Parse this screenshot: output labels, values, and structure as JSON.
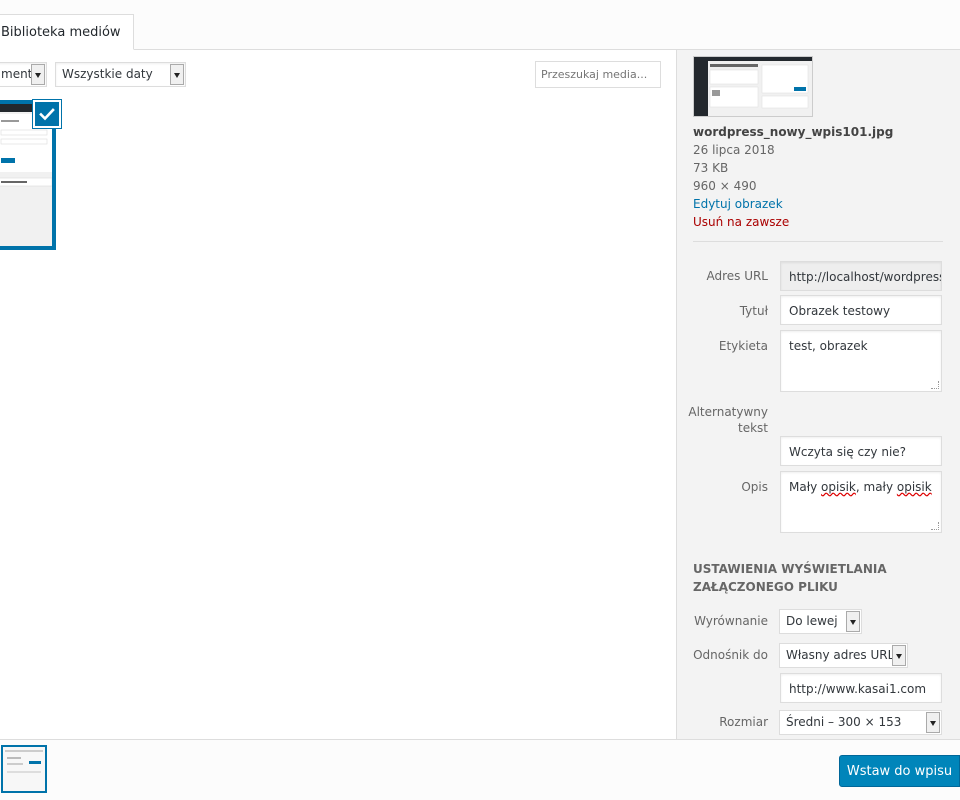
{
  "tabs": {
    "library": "Biblioteka mediów"
  },
  "toolbar": {
    "type_filter": "menty",
    "date_filter": "Wszystkie daty",
    "search_placeholder": "Przeszukaj media..."
  },
  "attachment": {
    "filename": "wordpress_nowy_wpis101.jpg",
    "date": "26 lipca 2018",
    "size": "73 KB",
    "dimensions": "960 × 490",
    "edit_link": "Edytuj obrazek",
    "delete_link": "Usuń na zawsze"
  },
  "fields": {
    "url_label": "Adres URL",
    "url_value": "http://localhost/wordpress/",
    "title_label": "Tytuł",
    "title_value": "Obrazek testowy",
    "caption_label": "Etykieta",
    "caption_value": "test, obrazek",
    "alt_label_1": "Alternatywny",
    "alt_label_2": "tekst",
    "alt_value": "Wczyta się czy nie?",
    "desc_label": "Opis",
    "desc_value_1": "Mały ",
    "desc_value_2": "opisik",
    "desc_value_3": ", mały ",
    "desc_value_4": "opisik"
  },
  "display": {
    "section_title": "USTAWIENIA WYŚWIETLANIA ZAŁĄCZONEGO PLIKU",
    "align_label": "Wyrównanie",
    "align_value": "Do lewej",
    "link_label": "Odnośnik do",
    "link_value": "Własny adres URL",
    "link_url": "http://www.kasai1.com",
    "size_label": "Rozmiar",
    "size_value": "Średni – 300 × 153"
  },
  "footer": {
    "insert_button": "Wstaw do wpisu"
  },
  "icons": {
    "selected": "checkmark-icon"
  },
  "colors": {
    "accent": "#0073aa",
    "button": "#0085ba",
    "danger": "#aa0000"
  }
}
